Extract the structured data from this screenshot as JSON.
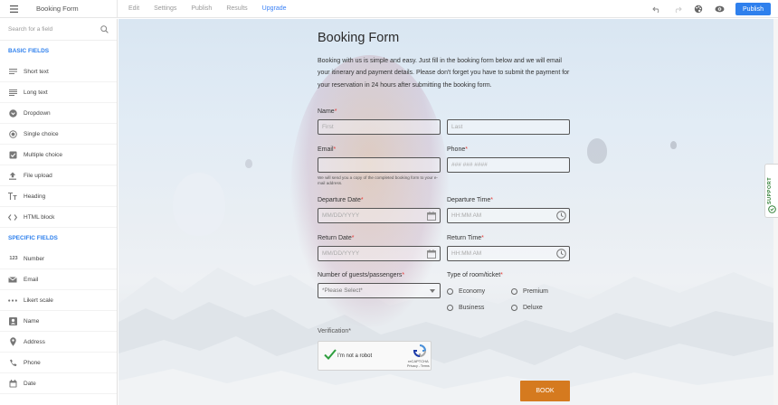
{
  "topbar": {
    "app_title": "Booking Form",
    "nav": [
      "Edit",
      "Settings",
      "Publish",
      "Results",
      "Upgrade"
    ],
    "publish_label": "Publish"
  },
  "sidebar": {
    "search_placeholder": "Search for a field",
    "basic_title": "BASIC FIELDS",
    "basic_fields": [
      "Short text",
      "Long text",
      "Dropdown",
      "Single choice",
      "Multiple choice",
      "File upload",
      "Heading",
      "HTML block"
    ],
    "specific_title": "SPECIFIC FIELDS",
    "specific_fields": [
      "Number",
      "Email",
      "Likert scale",
      "Name",
      "Address",
      "Phone",
      "Date"
    ],
    "number_icon_text": "123"
  },
  "form": {
    "title": "Booking Form",
    "description": "Booking with us is simple and easy. Just fill in the booking form below and we will email your itinerary and payment details.  Please don't forget you have to submit the payment for your reservation in 24 hours after submitting the booking form.",
    "name_label": "Name",
    "first_placeholder": "First",
    "last_placeholder": "Last",
    "email_label": "Email",
    "email_hint": "We will send you a copy of the completed booking form to your e-mail address.",
    "phone_label": "Phone",
    "phone_placeholder": "### ### ####",
    "departure_date_label": "Departure Date",
    "departure_date_placeholder": "MM/DD/YYYY",
    "departure_time_label": "Departure Time",
    "departure_time_placeholder": "HH:MM AM",
    "return_date_label": "Return Date",
    "return_date_placeholder": "MM/DD/YYYY",
    "return_time_label": "Return Time",
    "return_time_placeholder": "HH:MM AM",
    "guests_label": "Number of guests/passengers",
    "guests_placeholder": "*Please Select*",
    "room_label": "Type of room/ticket",
    "room_options": [
      "Economy",
      "Premium",
      "Business",
      "Deluxe"
    ],
    "verification_label": "Verification",
    "captcha_text": "I'm not a robot",
    "captcha_brand": "reCAPTCHA",
    "captcha_links": "Privacy - Terms",
    "required_mark": "*",
    "book_label": "BOOK"
  },
  "support_label": "SUPPORT",
  "colors": {
    "accent": "#2f80ed",
    "book": "#d57a1f",
    "required": "#e53935"
  }
}
